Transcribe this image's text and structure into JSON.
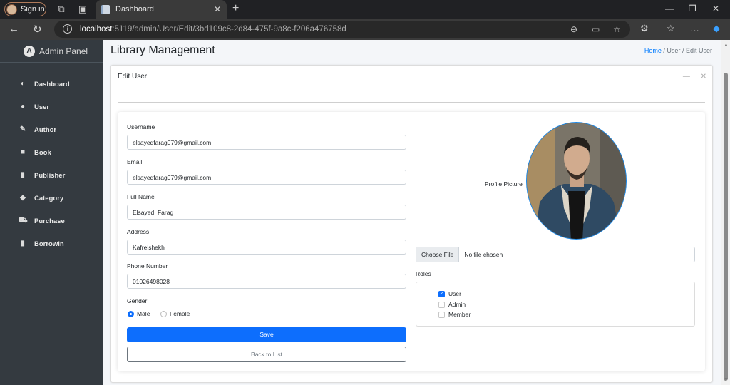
{
  "browser": {
    "signin_label": "Sign in",
    "tab_title": "Dashboard",
    "url_host": "localhost",
    "url_path": ":5119/admin/User/Edit/3bd109c8-2d84-475f-9a8c-f206a476758d"
  },
  "sidebar": {
    "brand": "Admin Panel",
    "brand_logo": "A",
    "items": [
      {
        "label": "Dashboard",
        "icon": "palette-icon"
      },
      {
        "label": "User",
        "icon": "user-icon"
      },
      {
        "label": "Author",
        "icon": "edit-icon"
      },
      {
        "label": "Book",
        "icon": "book-icon"
      },
      {
        "label": "Publisher",
        "icon": "book-icon"
      },
      {
        "label": "Category",
        "icon": "tag-icon"
      },
      {
        "label": "Purchase",
        "icon": "cart-icon"
      },
      {
        "label": "Borrowin",
        "icon": "book-icon"
      }
    ]
  },
  "header": {
    "title": "Library Management",
    "breadcrumb": {
      "home": "Home",
      "sep1": "/",
      "section": "User",
      "sep2": "/",
      "current": "Edit User"
    }
  },
  "card": {
    "title": "Edit User"
  },
  "form": {
    "username_label": "Username",
    "username_value": "elsayedfarag079@gmail.com",
    "email_label": "Email",
    "email_value": "elsayedfarag079@gmail.com",
    "fullname_label": "Full Name",
    "fullname_value": "Elsayed  Farag",
    "address_label": "Address",
    "address_value": "Kafrelshekh",
    "phone_label": "Phone Number",
    "phone_value": "01026498028",
    "gender_label": "Gender",
    "gender_male": "Male",
    "gender_female": "Female",
    "gender_selected": "Male",
    "profile_picture_label": "Profile Picture",
    "file_button": "Choose File",
    "file_status": "No file chosen",
    "roles_label": "Roles",
    "roles": [
      {
        "label": "User",
        "checked": true
      },
      {
        "label": "Admin",
        "checked": false
      },
      {
        "label": "Member",
        "checked": false
      }
    ],
    "save_label": "Save",
    "back_label": "Back to List"
  },
  "colors": {
    "primary": "#0d6efd",
    "sidebar": "#343a40",
    "link": "#007bff"
  }
}
